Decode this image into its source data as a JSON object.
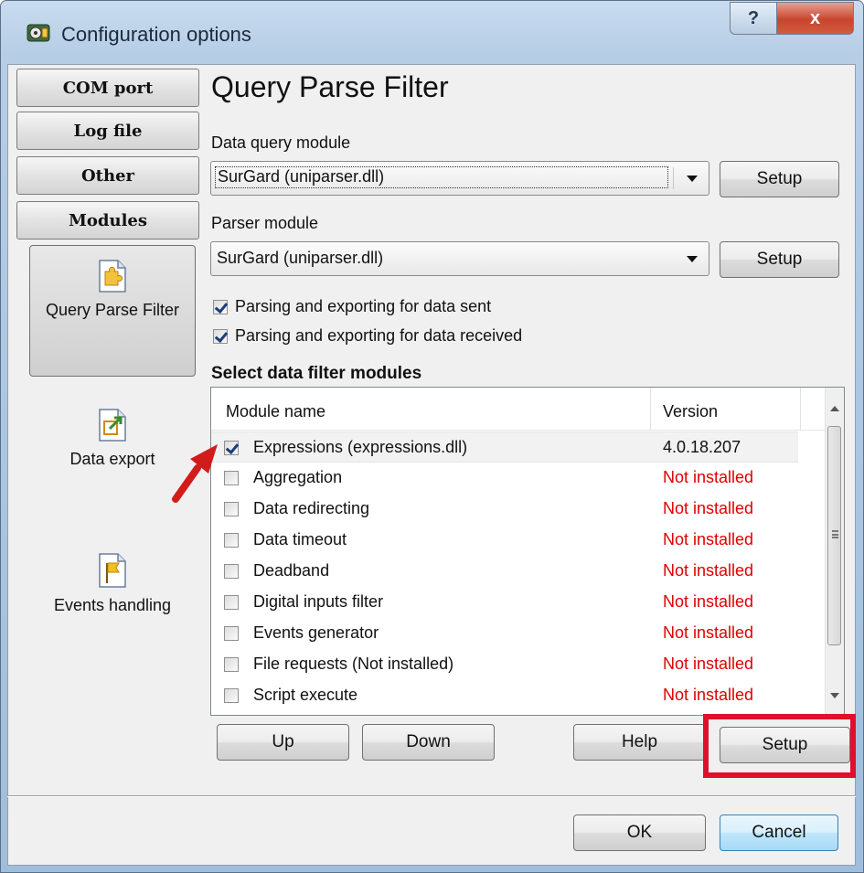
{
  "window": {
    "title": "Configuration options",
    "help_label": "?",
    "close_label": "x"
  },
  "nav": {
    "com_port": "COM port",
    "log_file": "Log file",
    "other": "Other",
    "modules": "Modules",
    "query_parse_filter": "Query Parse Filter",
    "data_export": "Data export",
    "events_handling": "Events handling",
    "active": "Query Parse Filter"
  },
  "page": {
    "heading": "Query Parse Filter",
    "data_query_label": "Data query module",
    "data_query_value": "SurGard (uniparser.dll)",
    "parser_label": "Parser module",
    "parser_value": "SurGard (uniparser.dll)",
    "setup_label": "Setup",
    "chk_sent": {
      "label": "Parsing and exporting for data sent",
      "checked": true
    },
    "chk_received": {
      "label": "Parsing and exporting for data received",
      "checked": true
    },
    "filter_section": "Select data filter modules"
  },
  "modules_table": {
    "columns": [
      "Module name",
      "Version"
    ],
    "rows": [
      {
        "name": "Expressions (expressions.dll)",
        "version": "4.0.18.207",
        "checked": true
      },
      {
        "name": "Aggregation",
        "version": "Not installed",
        "checked": false
      },
      {
        "name": "Data redirecting",
        "version": "Not installed",
        "checked": false
      },
      {
        "name": "Data timeout",
        "version": "Not installed",
        "checked": false
      },
      {
        "name": "Deadband",
        "version": "Not installed",
        "checked": false
      },
      {
        "name": "Digital inputs filter",
        "version": "Not installed",
        "checked": false
      },
      {
        "name": "Events generator",
        "version": "Not installed",
        "checked": false
      },
      {
        "name": "File requests (Not installed)",
        "version": "Not installed",
        "checked": false
      },
      {
        "name": "Script execute",
        "version": "Not installed",
        "checked": false
      }
    ]
  },
  "buttons": {
    "up": "Up",
    "down": "Down",
    "help": "Help",
    "setup": "Setup",
    "ok": "OK",
    "cancel": "Cancel"
  },
  "colors": {
    "not_installed": "#e00000",
    "highlight_box": "#e0102a"
  }
}
